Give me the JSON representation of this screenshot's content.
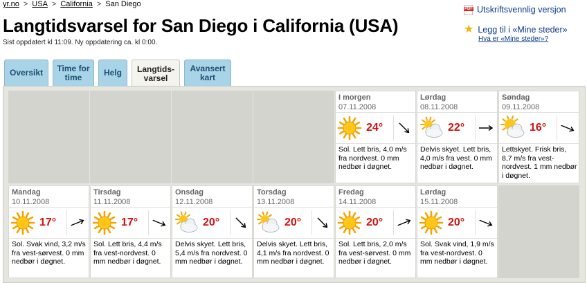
{
  "breadcrumb": {
    "home": "yr.no",
    "country": "USA",
    "state": "California",
    "city": "San Diego"
  },
  "page": {
    "title": "Langtidsvarsel for San Diego i California (USA)",
    "updated": "Sist oppdatert kl 11:09. Ny oppdatering ca. kl 0:00."
  },
  "tools": {
    "print_label": "Utskriftsvennlig versjon",
    "save_label": "Legg til i «Mine steder»",
    "help_label": "Hva er «Mine steder»?"
  },
  "tabs": [
    {
      "label": "Oversikt"
    },
    {
      "label": "Time for time"
    },
    {
      "label": "Helg"
    },
    {
      "label": "Langtids-varsel"
    },
    {
      "label": "Avansert kart"
    }
  ],
  "forecast": {
    "week1": [
      {
        "day": "I morgen",
        "date": "07.11.2008",
        "icon": "sun-icon",
        "temp": "24°",
        "wind_dir": "from-northwest",
        "desc": "Sol. Lett bris, 4,0 m/s fra nordvest. 0 mm nedbør i døgnet."
      },
      {
        "day": "Lørdag",
        "date": "08.11.2008",
        "icon": "partly-cloudy-icon",
        "temp": "22°",
        "wind_dir": "from-west",
        "desc": "Delvis skyet. Lett bris, 4,0 m/s fra vest. 0 mm nedbør i døgnet."
      },
      {
        "day": "Søndag",
        "date": "09.11.2008",
        "icon": "light-cloud-icon",
        "temp": "16°",
        "wind_dir": "from-west-northwest",
        "desc": "Lettskyet. Frisk bris, 8,7 m/s fra vest-nordvest. 1 mm nedbør i døgnet."
      }
    ],
    "week2": [
      {
        "day": "Mandag",
        "date": "10.11.2008",
        "icon": "sun-icon",
        "temp": "17°",
        "wind_dir": "from-west-southwest",
        "desc": "Sol. Svak vind, 3,2 m/s fra vest-sørvest. 0 mm nedbør i døgnet."
      },
      {
        "day": "Tirsdag",
        "date": "11.11.2008",
        "icon": "sun-icon",
        "temp": "17°",
        "wind_dir": "from-west-northwest",
        "desc": "Sol. Lett bris, 4,4 m/s fra vest-nordvest. 0 mm nedbør i døgnet."
      },
      {
        "day": "Onsdag",
        "date": "12.11.2008",
        "icon": "partly-cloudy-icon",
        "temp": "20°",
        "wind_dir": "from-northwest",
        "desc": "Delvis skyet. Lett bris, 5,4 m/s fra nordvest. 0 mm nedbør i døgnet."
      },
      {
        "day": "Torsdag",
        "date": "13.11.2008",
        "icon": "partly-cloudy-icon",
        "temp": "20°",
        "wind_dir": "from-northwest",
        "desc": "Delvis skyet. Lett bris, 4,1 m/s fra nordvest. 0 mm nedbør i døgnet."
      },
      {
        "day": "Fredag",
        "date": "14.11.2008",
        "icon": "sun-icon",
        "temp": "20°",
        "wind_dir": "from-west-southwest",
        "desc": "Sol. Lett bris, 2,0 m/s fra vest-sørvest. 0 mm nedbør i døgnet."
      },
      {
        "day": "Lørdag",
        "date": "15.11.2008",
        "icon": "sun-icon",
        "temp": "20°",
        "wind_dir": "from-west-northwest",
        "desc": "Sol. Svak vind, 1,9 m/s fra vest-nordvest. 0 mm nedbør i døgnet."
      }
    ]
  },
  "colors": {
    "temp": "#d11010",
    "tab_bg": "#a9d3e6",
    "tab_active_bg": "#f4f3ee",
    "link": "#0b3a8a"
  }
}
